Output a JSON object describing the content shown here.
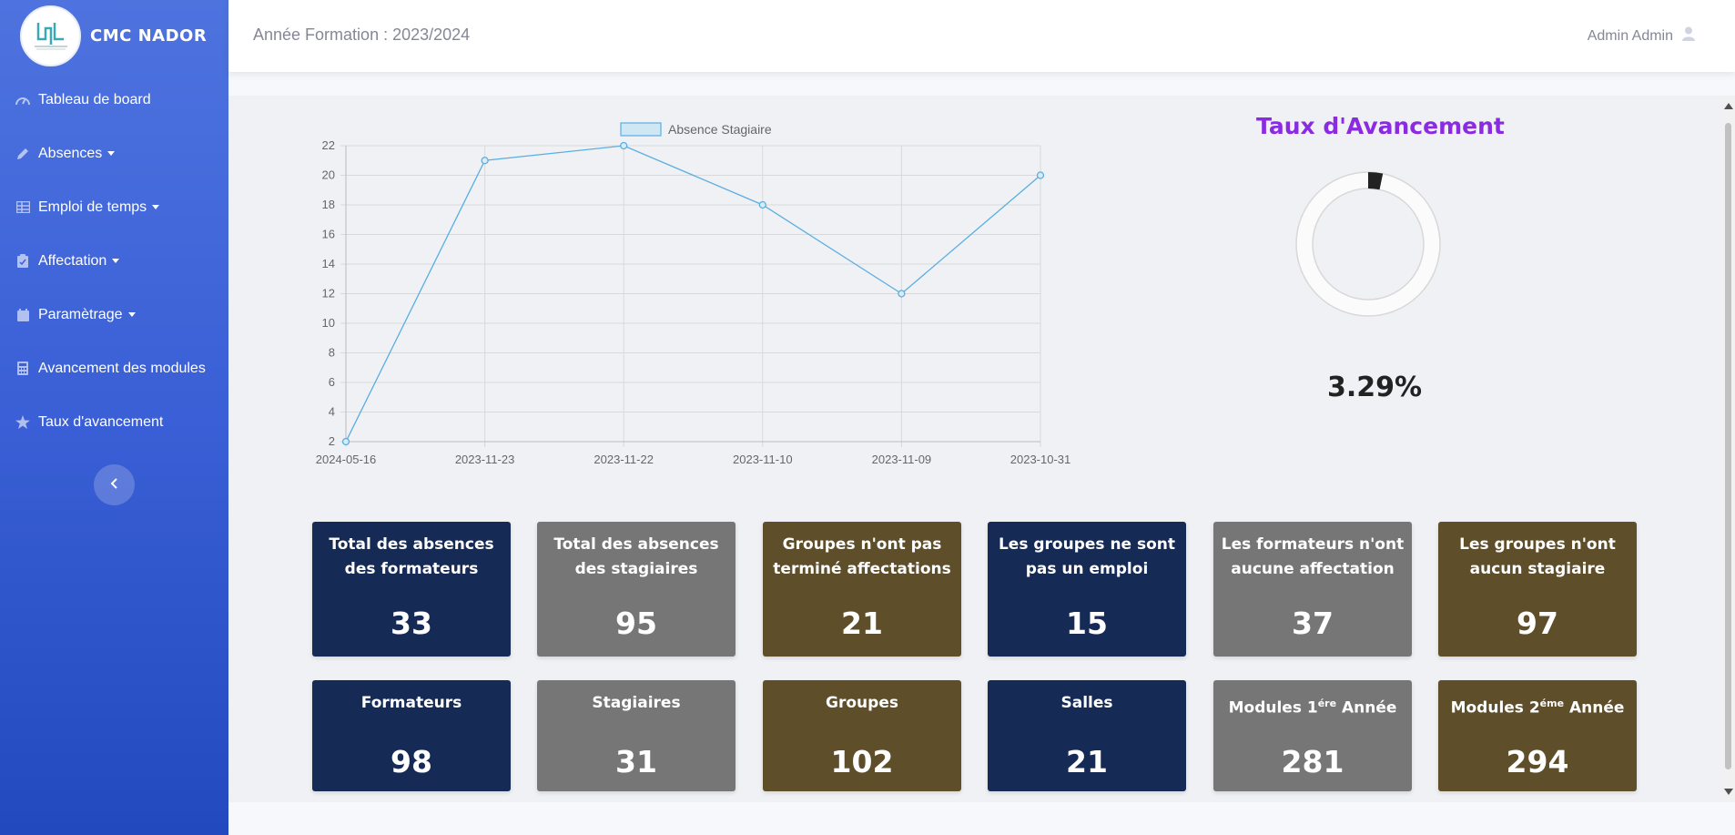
{
  "sidebar": {
    "brand_name": "CMC NADOR",
    "items": [
      {
        "label": "Tableau de board",
        "icon": "dashboard-icon"
      },
      {
        "label": "Absences",
        "icon": "pencil-icon",
        "dropdown": true
      },
      {
        "label": "Emploi de temps",
        "icon": "table-icon",
        "dropdown": true
      },
      {
        "label": "Affectation",
        "icon": "clipboard-icon",
        "dropdown": true
      },
      {
        "label": "Paramètrage",
        "icon": "calendar-icon",
        "dropdown": true
      },
      {
        "label": "Avancement des modules",
        "icon": "calculator-icon"
      },
      {
        "label": "Taux d'avancement",
        "icon": "star-icon"
      }
    ]
  },
  "header": {
    "year_text": "Année Formation : 2023/2024",
    "user_name": "Admin Admin"
  },
  "taux": {
    "title": "Taux d'Avancement",
    "percent_text": "3.29%",
    "percent_value": 3.29
  },
  "chart_data": {
    "type": "line",
    "title": "",
    "legend": "Absence Stagiaire",
    "legend_position": "top",
    "categories": [
      "2024-05-16",
      "2023-11-23",
      "2023-11-22",
      "2023-11-10",
      "2023-11-09",
      "2023-10-31"
    ],
    "series": [
      {
        "name": "Absence Stagiaire",
        "values": [
          2,
          21,
          22,
          18,
          12,
          20
        ]
      }
    ],
    "ylim": [
      2,
      22
    ],
    "yticks": [
      2,
      4,
      6,
      8,
      10,
      12,
      14,
      16,
      18,
      20,
      22
    ],
    "grid": true,
    "color": "#5aaee0"
  },
  "cards_row1": [
    {
      "label": "Total des absences des formateurs",
      "value": "33",
      "color": "navy"
    },
    {
      "label": "Total des absences des stagiaires",
      "value": "95",
      "color": "gray"
    },
    {
      "label": "Groupes n'ont pas terminé affectations",
      "value": "21",
      "color": "brown"
    },
    {
      "label": "Les groupes ne sont pas un emploi",
      "value": "15",
      "color": "navy"
    },
    {
      "label": "Les formateurs n'ont aucune affectation",
      "value": "37",
      "color": "gray"
    },
    {
      "label": "Les groupes n'ont aucun stagiaire",
      "value": "97",
      "color": "brown"
    }
  ],
  "cards_row2": [
    {
      "label": "Formateurs",
      "value": "98"
    },
    {
      "label": "Stagiaires",
      "value": "31"
    },
    {
      "label": "Groupes",
      "value": "102"
    },
    {
      "label": "Salles",
      "value": "21"
    },
    {
      "label_pre": "Modules 1",
      "label_sup": "ére",
      "label_post": " Année",
      "value": "281"
    },
    {
      "label_pre": "Modules 2",
      "label_sup": "éme",
      "label_post": " Année",
      "value": "294"
    }
  ]
}
